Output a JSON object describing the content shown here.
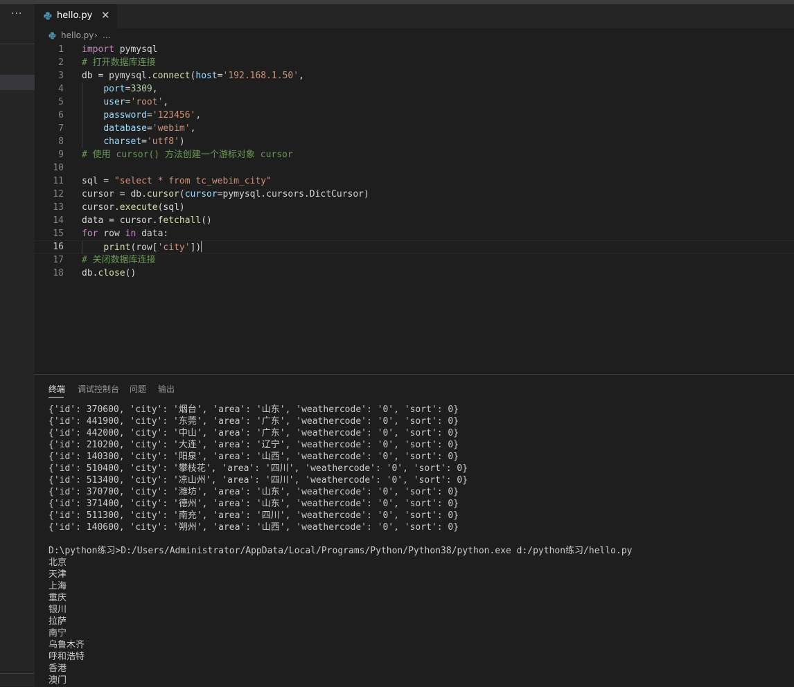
{
  "sidebar": {
    "more_label": "···"
  },
  "tab": {
    "filename": "hello.py",
    "close": "✕"
  },
  "breadcrumb": {
    "file": "hello.py",
    "sep": "›",
    "more": "..."
  },
  "editor": {
    "lines": [
      {
        "n": "1",
        "tokens": [
          [
            "kw",
            "import"
          ],
          [
            "tx",
            " pymysql"
          ]
        ]
      },
      {
        "n": "2",
        "tokens": [
          [
            "cm",
            "# 打开数据库连接"
          ]
        ]
      },
      {
        "n": "3",
        "tokens": [
          [
            "tx",
            "db = pymysql."
          ],
          [
            "fn",
            "connect"
          ],
          [
            "tx",
            "("
          ],
          [
            "pm",
            "host"
          ],
          [
            "tx",
            "="
          ],
          [
            "str",
            "'192.168.1.50'"
          ],
          [
            "tx",
            ","
          ]
        ]
      },
      {
        "n": "4",
        "indent": true,
        "tokens": [
          [
            "tx",
            "    "
          ],
          [
            "pm",
            "port"
          ],
          [
            "tx",
            "="
          ],
          [
            "num",
            "3309"
          ],
          [
            "tx",
            ","
          ]
        ]
      },
      {
        "n": "5",
        "indent": true,
        "tokens": [
          [
            "tx",
            "    "
          ],
          [
            "pm",
            "user"
          ],
          [
            "tx",
            "="
          ],
          [
            "str",
            "'root'"
          ],
          [
            "tx",
            ","
          ]
        ]
      },
      {
        "n": "6",
        "indent": true,
        "tokens": [
          [
            "tx",
            "    "
          ],
          [
            "pm",
            "password"
          ],
          [
            "tx",
            "="
          ],
          [
            "str",
            "'123456'"
          ],
          [
            "tx",
            ","
          ]
        ]
      },
      {
        "n": "7",
        "indent": true,
        "tokens": [
          [
            "tx",
            "    "
          ],
          [
            "pm",
            "database"
          ],
          [
            "tx",
            "="
          ],
          [
            "str",
            "'webim'"
          ],
          [
            "tx",
            ","
          ]
        ]
      },
      {
        "n": "8",
        "indent": true,
        "tokens": [
          [
            "tx",
            "    "
          ],
          [
            "pm",
            "charset"
          ],
          [
            "tx",
            "="
          ],
          [
            "str",
            "'utf8'"
          ],
          [
            "tx",
            ")"
          ]
        ]
      },
      {
        "n": "9",
        "tokens": [
          [
            "cm",
            "# 使用 cursor() 方法创建一个游标对象 cursor"
          ]
        ]
      },
      {
        "n": "10",
        "tokens": []
      },
      {
        "n": "11",
        "tokens": [
          [
            "tx",
            "sql = "
          ],
          [
            "str",
            "\"select * from tc_webim_city\""
          ]
        ]
      },
      {
        "n": "12",
        "tokens": [
          [
            "tx",
            "cursor = db."
          ],
          [
            "fn",
            "cursor"
          ],
          [
            "tx",
            "("
          ],
          [
            "pm",
            "cursor"
          ],
          [
            "tx",
            "=pymysql.cursors.DictCursor)"
          ]
        ]
      },
      {
        "n": "13",
        "tokens": [
          [
            "tx",
            "cursor."
          ],
          [
            "fn",
            "execute"
          ],
          [
            "tx",
            "(sql)"
          ]
        ]
      },
      {
        "n": "14",
        "tokens": [
          [
            "tx",
            "data = cursor."
          ],
          [
            "fn",
            "fetchall"
          ],
          [
            "tx",
            "()"
          ]
        ]
      },
      {
        "n": "15",
        "tokens": [
          [
            "kw",
            "for"
          ],
          [
            "tx",
            " row "
          ],
          [
            "kw",
            "in"
          ],
          [
            "tx",
            " data:"
          ]
        ]
      },
      {
        "n": "16",
        "indent": true,
        "current": true,
        "tokens": [
          [
            "tx",
            "    "
          ],
          [
            "fn",
            "print"
          ],
          [
            "tx",
            "(row["
          ],
          [
            "str",
            "'city'"
          ],
          [
            "tx",
            "])"
          ]
        ]
      },
      {
        "n": "17",
        "tokens": [
          [
            "cm",
            "# 关闭数据库连接"
          ]
        ]
      },
      {
        "n": "18",
        "tokens": [
          [
            "tx",
            "db."
          ],
          [
            "fn",
            "close"
          ],
          [
            "tx",
            "()"
          ]
        ]
      }
    ]
  },
  "panel": {
    "tabs": [
      "终端",
      "调试控制台",
      "问题",
      "输出"
    ],
    "active_tab": "终端",
    "terminal_lines": [
      "{'id': 370600, 'city': '烟台', 'area': '山东', 'weathercode': '0', 'sort': 0}",
      "{'id': 441900, 'city': '东莞', 'area': '广东', 'weathercode': '0', 'sort': 0}",
      "{'id': 442000, 'city': '中山', 'area': '广东', 'weathercode': '0', 'sort': 0}",
      "{'id': 210200, 'city': '大连', 'area': '辽宁', 'weathercode': '0', 'sort': 0}",
      "{'id': 140300, 'city': '阳泉', 'area': '山西', 'weathercode': '0', 'sort': 0}",
      "{'id': 510400, 'city': '攀枝花', 'area': '四川', 'weathercode': '0', 'sort': 0}",
      "{'id': 513400, 'city': '凉山州', 'area': '四川', 'weathercode': '0', 'sort': 0}",
      "{'id': 370700, 'city': '潍坊', 'area': '山东', 'weathercode': '0', 'sort': 0}",
      "{'id': 371400, 'city': '德州', 'area': '山东', 'weathercode': '0', 'sort': 0}",
      "{'id': 511300, 'city': '南充', 'area': '四川', 'weathercode': '0', 'sort': 0}",
      "{'id': 140600, 'city': '朔州', 'area': '山西', 'weathercode': '0', 'sort': 0}",
      "",
      "D:\\python练习>D:/Users/Administrator/AppData/Local/Programs/Python/Python38/python.exe d:/python练习/hello.py",
      "北京",
      "天津",
      "上海",
      "重庆",
      "银川",
      "拉萨",
      "南宁",
      "乌鲁木齐",
      "呼和浩特",
      "香港",
      "澳门"
    ]
  },
  "colors": {
    "background": "#1e1e1e",
    "sidebar": "#252526",
    "keyword": "#c586c0",
    "string": "#ce9178",
    "comment": "#6a9955",
    "number": "#b5cea8",
    "param": "#9cdcfe",
    "function": "#dcdcaa"
  }
}
